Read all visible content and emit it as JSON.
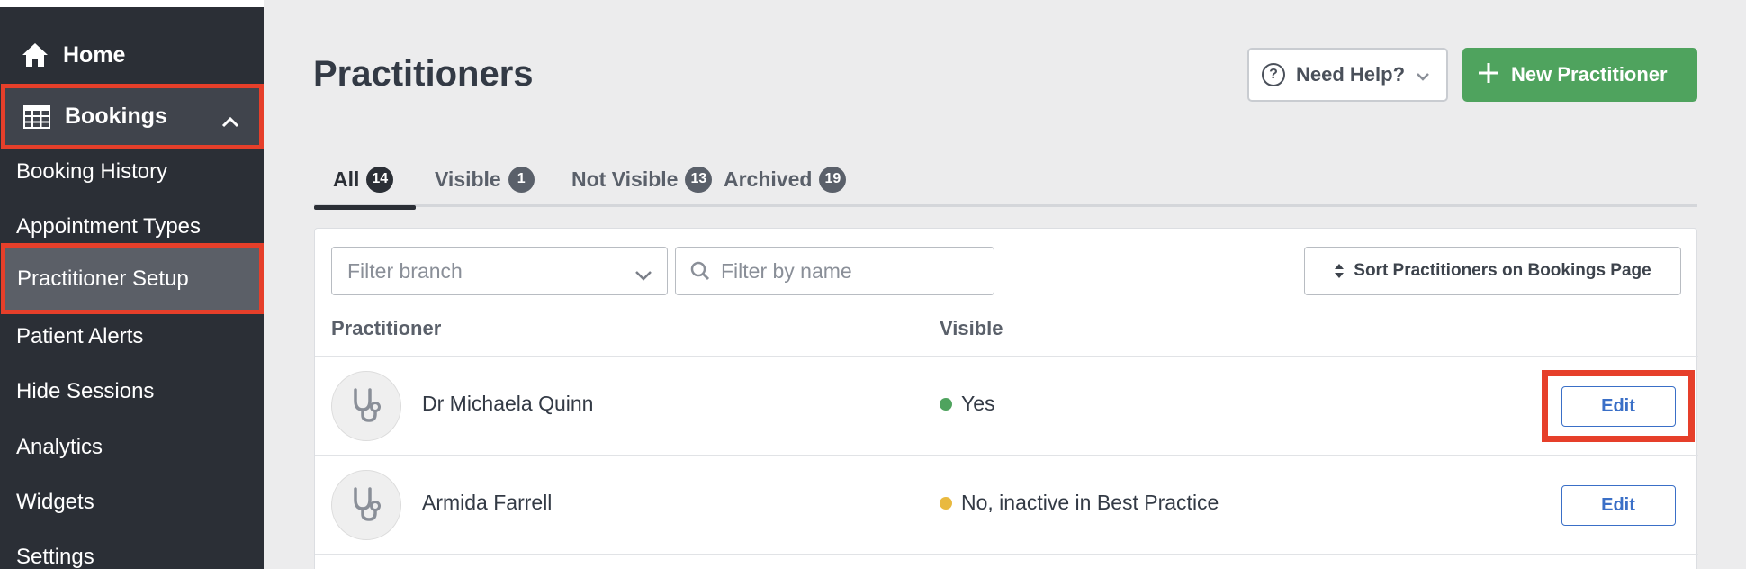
{
  "sidebar": {
    "home_label": "Home",
    "bookings_label": "Bookings",
    "items": [
      {
        "label": "Booking History"
      },
      {
        "label": "Appointment Types"
      },
      {
        "label": "Practitioner Setup"
      },
      {
        "label": "Patient Alerts"
      },
      {
        "label": "Hide Sessions"
      },
      {
        "label": "Analytics"
      },
      {
        "label": "Widgets"
      },
      {
        "label": "Settings"
      }
    ]
  },
  "header": {
    "title": "Practitioners",
    "help_label": "Need Help?",
    "new_label": "New Practitioner"
  },
  "tabs": [
    {
      "label": "All",
      "count": "14"
    },
    {
      "label": "Visible",
      "count": "1"
    },
    {
      "label": "Not Visible",
      "count": "13"
    },
    {
      "label": "Archived",
      "count": "19"
    }
  ],
  "filters": {
    "branch_placeholder": "Filter branch",
    "name_placeholder": "Filter by name",
    "sort_label": "Sort Practitioners on Bookings Page"
  },
  "table": {
    "columns": [
      "Practitioner",
      "Visible"
    ],
    "rows": [
      {
        "name": "Dr Michaela Quinn",
        "visible": "Yes",
        "status_color": "#4fa35e",
        "action": "Edit"
      },
      {
        "name": "Armida Farrell",
        "visible": "No, inactive in Best Practice",
        "status_color": "#e9b93f",
        "action": "Edit"
      }
    ]
  },
  "colors": {
    "highlight": "#e63f2a",
    "primary_green": "#4fa35e",
    "link_blue": "#3a6fc7",
    "sidebar_bg": "#2b2f36"
  },
  "icons": [
    "home-icon",
    "grid-table-icon",
    "chevron-up-icon",
    "question-circle-icon",
    "chevron-down-icon",
    "plus-icon",
    "search-icon",
    "sort-icon",
    "stethoscope-icon"
  ]
}
